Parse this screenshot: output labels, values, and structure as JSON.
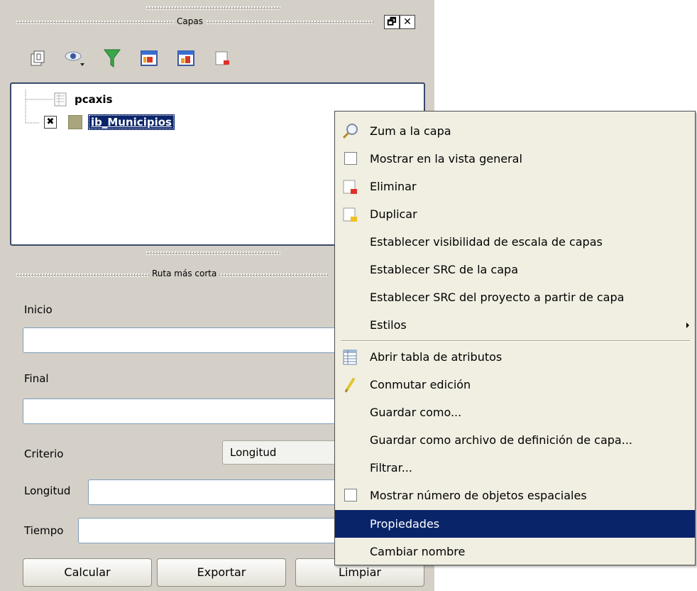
{
  "layers_panel": {
    "title": "Capas",
    "float_button": "🗗",
    "close_button": "✕",
    "toolbar": [
      {
        "name": "add-group-icon"
      },
      {
        "name": "visibility-eye-icon"
      },
      {
        "name": "filter-icon"
      },
      {
        "name": "expand-all-icon"
      },
      {
        "name": "collapse-all-icon"
      },
      {
        "name": "remove-layer-icon"
      }
    ],
    "tree": {
      "group_label": "pcaxis",
      "layer_label": "ib_Municipios",
      "layer_checked_glyph": "✖",
      "layer_color": "#a9a57c"
    }
  },
  "route_panel": {
    "title": "Ruta más corta",
    "start_label": "Inicio",
    "start_value": "",
    "end_label": "Final",
    "end_value": "",
    "criterion_label": "Criterio",
    "criterion_value": "Longitud",
    "length_label": "Longitud",
    "length_value": "",
    "time_label": "Tiempo",
    "time_value": "",
    "buttons": {
      "calculate": "Calcular",
      "export": "Exportar",
      "clear": "Limpiar"
    }
  },
  "context_menu": {
    "items": [
      {
        "label": "Zum a la capa",
        "icon": "zoom-icon"
      },
      {
        "label": "Mostrar en la vista general",
        "icon": "checkbox"
      },
      {
        "label": "Eliminar",
        "icon": "remove-icon"
      },
      {
        "label": "Duplicar",
        "icon": "duplicate-icon"
      },
      {
        "label": "Establecer visibilidad de escala de capas"
      },
      {
        "label": "Establecer SRC de la capa"
      },
      {
        "label": "Establecer SRC del proyecto a partir de capa"
      },
      {
        "label": "Estilos",
        "submenu": true
      },
      {
        "label": "Abrir tabla de atributos",
        "icon": "table-icon"
      },
      {
        "label": "Conmutar edición",
        "icon": "pencil-icon"
      },
      {
        "label": "Guardar como..."
      },
      {
        "label": "Guardar como archivo de definición de capa..."
      },
      {
        "label": "Filtrar..."
      },
      {
        "label": "Mostrar número de objetos espaciales",
        "icon": "checkbox"
      },
      {
        "label": "Propiedades",
        "highlighted": true
      },
      {
        "label": "Cambiar nombre"
      }
    ],
    "highlight_color": "#0a246a"
  }
}
